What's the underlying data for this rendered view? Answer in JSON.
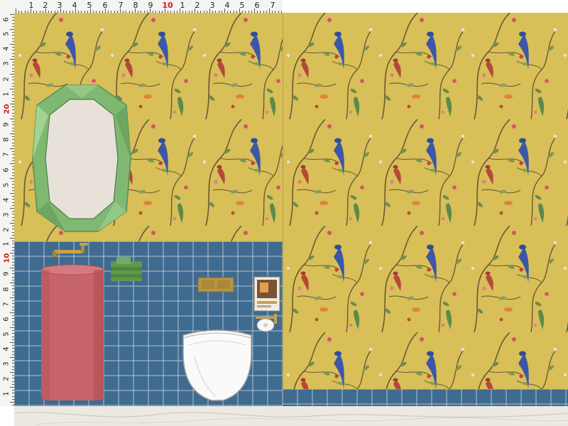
{
  "ruler_top": {
    "labels": [
      "1",
      "2",
      "3",
      "4",
      "5",
      "6",
      "7",
      "8",
      "9",
      "10",
      "1",
      "2",
      "3",
      "4",
      "5",
      "6",
      "7"
    ],
    "highlight_label": "10"
  },
  "ruler_left": {
    "labels": [
      "6",
      "5",
      "4",
      "3",
      "2",
      "1",
      "20",
      "9",
      "8",
      "7",
      "6",
      "5",
      "4",
      "3",
      "2",
      "1",
      "10",
      "9",
      "8",
      "7",
      "6",
      "5",
      "4",
      "3",
      "2",
      "1"
    ],
    "highlight_labels": [
      "20",
      "10"
    ]
  },
  "colors": {
    "wallpaper": "#d8bf58",
    "tile": "#3f6b90",
    "grout": "#cfd9e2",
    "sink": "#c6646a",
    "mirror_frame": "#7fb870",
    "towel": "#5e9a4c",
    "brass": "#c8a24a",
    "floor": "#ece9e3"
  }
}
